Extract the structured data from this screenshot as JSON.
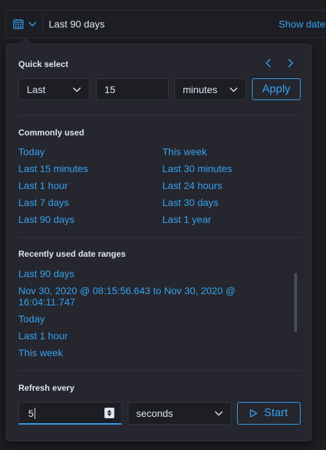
{
  "header": {
    "calendar_icon": "calendar-icon",
    "current_range": "Last 90 days",
    "show_dates_label": "Show dates"
  },
  "quick_select": {
    "title": "Quick select",
    "tense_value": "Last",
    "amount_value": "15",
    "unit_value": "minutes",
    "apply_label": "Apply"
  },
  "commonly_used": {
    "title": "Commonly used",
    "items": [
      "Today",
      "This week",
      "Last 15 minutes",
      "Last 30 minutes",
      "Last 1 hour",
      "Last 24 hours",
      "Last 7 days",
      "Last 30 days",
      "Last 90 days",
      "Last 1 year"
    ]
  },
  "recently_used": {
    "title": "Recently used date ranges",
    "items": [
      "Last 90 days",
      "Nov 30, 2020 @ 08:15:56.643 to Nov 30, 2020 @ 16:04:11.747",
      "Today",
      "Last 1 hour",
      "This week"
    ]
  },
  "refresh": {
    "title": "Refresh every",
    "interval_value": "5",
    "unit_value": "seconds",
    "start_label": "Start"
  },
  "colors": {
    "accent": "#36a2ef",
    "background": "#1d1e24",
    "panel": "#25262e",
    "text": "#dfe5ef"
  }
}
